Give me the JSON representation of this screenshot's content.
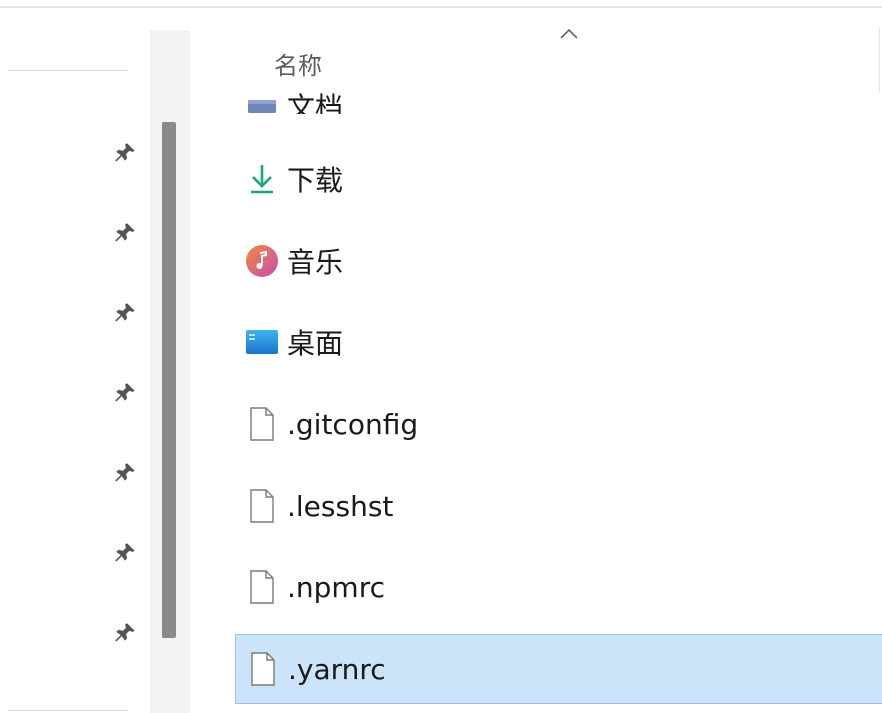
{
  "list_header": {
    "name_column": "名称"
  },
  "rows": [
    {
      "label": "文档",
      "icon": "documents-folder-icon"
    },
    {
      "label": "下载",
      "icon": "download-arrow-icon"
    },
    {
      "label": "音乐",
      "icon": "music-icon"
    },
    {
      "label": "桌面",
      "icon": "desktop-folder-icon"
    },
    {
      "label": ".gitconfig",
      "icon": "file-icon"
    },
    {
      "label": ".lesshst",
      "icon": "file-icon"
    },
    {
      "label": ".npmrc",
      "icon": "file-icon"
    },
    {
      "label": ".yarnrc",
      "icon": "file-icon",
      "selected": true
    }
  ],
  "colors": {
    "selected_bg": "#cce4fa",
    "selected_border": "#98c5ef",
    "download_accent": "#1aa57a",
    "desktop_accent": "#1e8ad6",
    "music_accent": "#e8604a"
  }
}
